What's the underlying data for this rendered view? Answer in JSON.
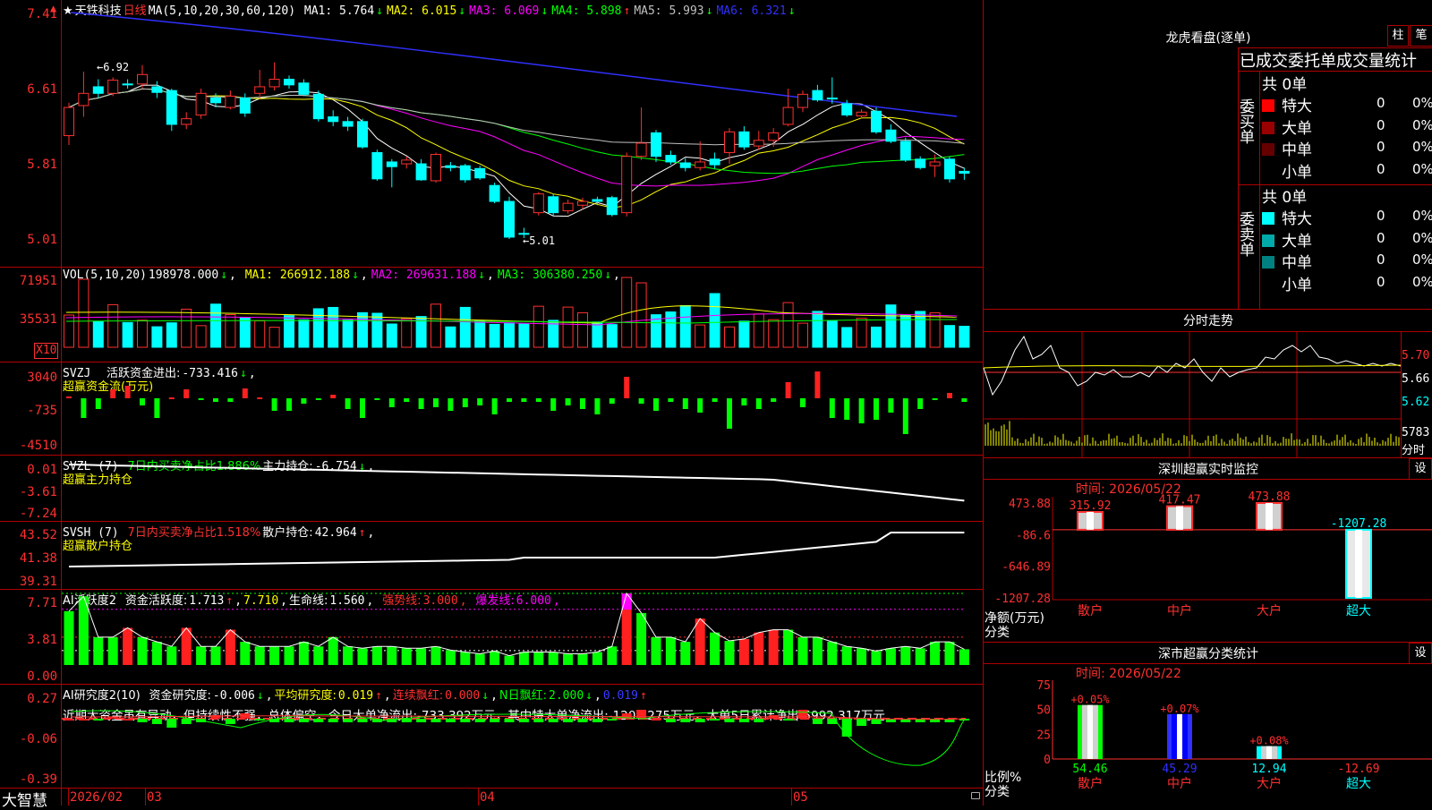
{
  "stock": {
    "star": "★",
    "name": "天铁科技",
    "period": "日线"
  },
  "kline": {
    "ma_params": "MA(5,10,20,30,60,120)",
    "ma": [
      {
        "label": "MA1:",
        "value": "5.764",
        "arrow": "↓",
        "color": "#ffffff"
      },
      {
        "label": "MA2:",
        "value": "6.015",
        "arrow": "↓",
        "color": "#ffff00"
      },
      {
        "label": "MA3:",
        "value": "6.069",
        "arrow": "↓",
        "color": "#ff00ff"
      },
      {
        "label": "MA4:",
        "value": "5.898",
        "arrow": "↑",
        "color": "#00ff00"
      },
      {
        "label": "MA5:",
        "value": "5.993",
        "arrow": "↓",
        "color": "#c0c0c0"
      },
      {
        "label": "MA6:",
        "value": "6.321",
        "arrow": "↓",
        "color": "#3030ff"
      }
    ],
    "y_ticks": [
      "7.41",
      "6.61",
      "5.81",
      "5.01"
    ],
    "high_label": "6.92",
    "low_label": "5.01",
    "candles": [
      {
        "o": 6.1,
        "c": 6.4,
        "h": 6.45,
        "l": 6.0
      },
      {
        "o": 6.42,
        "c": 6.55,
        "h": 6.78,
        "l": 6.3
      },
      {
        "o": 6.62,
        "c": 6.55,
        "h": 6.7,
        "l": 6.5
      },
      {
        "o": 6.55,
        "c": 6.69,
        "h": 6.72,
        "l": 6.52
      },
      {
        "o": 6.65,
        "c": 6.64,
        "h": 6.7,
        "l": 6.6
      },
      {
        "o": 6.65,
        "c": 6.75,
        "h": 6.85,
        "l": 6.6
      },
      {
        "o": 6.62,
        "c": 6.56,
        "h": 6.68,
        "l": 6.5
      },
      {
        "o": 6.58,
        "c": 6.22,
        "h": 6.6,
        "l": 6.15
      },
      {
        "o": 6.22,
        "c": 6.28,
        "h": 6.35,
        "l": 6.17
      },
      {
        "o": 6.32,
        "c": 6.55,
        "h": 6.6,
        "l": 6.28
      },
      {
        "o": 6.5,
        "c": 6.45,
        "h": 6.55,
        "l": 6.4
      },
      {
        "o": 6.4,
        "c": 6.52,
        "h": 6.58,
        "l": 6.38
      },
      {
        "o": 6.5,
        "c": 6.34,
        "h": 6.55,
        "l": 6.3
      },
      {
        "o": 6.55,
        "c": 6.62,
        "h": 6.8,
        "l": 6.5
      },
      {
        "o": 6.62,
        "c": 6.7,
        "h": 6.88,
        "l": 6.58
      },
      {
        "o": 6.7,
        "c": 6.64,
        "h": 6.74,
        "l": 6.6
      },
      {
        "o": 6.66,
        "c": 6.54,
        "h": 6.7,
        "l": 6.52
      },
      {
        "o": 6.54,
        "c": 6.28,
        "h": 6.58,
        "l": 6.25
      },
      {
        "o": 6.3,
        "c": 6.25,
        "h": 6.37,
        "l": 6.2
      },
      {
        "o": 6.25,
        "c": 6.2,
        "h": 6.3,
        "l": 6.15
      },
      {
        "o": 6.25,
        "c": 5.98,
        "h": 6.28,
        "l": 5.96
      },
      {
        "o": 5.92,
        "c": 5.64,
        "h": 5.95,
        "l": 5.62
      },
      {
        "o": 5.82,
        "c": 5.77,
        "h": 5.85,
        "l": 5.55
      },
      {
        "o": 5.8,
        "c": 5.84,
        "h": 5.88,
        "l": 5.75
      },
      {
        "o": 5.8,
        "c": 5.63,
        "h": 5.85,
        "l": 5.62
      },
      {
        "o": 5.62,
        "c": 5.9,
        "h": 5.92,
        "l": 5.6
      },
      {
        "o": 5.78,
        "c": 5.76,
        "h": 5.82,
        "l": 5.72
      },
      {
        "o": 5.78,
        "c": 5.63,
        "h": 5.8,
        "l": 5.6
      },
      {
        "o": 5.75,
        "c": 5.65,
        "h": 5.78,
        "l": 5.63
      },
      {
        "o": 5.57,
        "c": 5.4,
        "h": 5.6,
        "l": 5.38
      },
      {
        "o": 5.4,
        "c": 5.02,
        "h": 5.45,
        "l": 5.0
      },
      {
        "o": 5.06,
        "c": 5.05,
        "h": 5.12,
        "l": 5.01
      },
      {
        "o": 5.28,
        "c": 5.48,
        "h": 5.5,
        "l": 5.25
      },
      {
        "o": 5.45,
        "c": 5.28,
        "h": 5.48,
        "l": 5.25
      },
      {
        "o": 5.3,
        "c": 5.38,
        "h": 5.42,
        "l": 5.27
      },
      {
        "o": 5.36,
        "c": 5.4,
        "h": 5.44,
        "l": 5.32
      },
      {
        "o": 5.42,
        "c": 5.4,
        "h": 5.45,
        "l": 5.36
      },
      {
        "o": 5.44,
        "c": 5.26,
        "h": 5.46,
        "l": 5.24
      },
      {
        "o": 5.28,
        "c": 5.88,
        "h": 5.92,
        "l": 5.24
      },
      {
        "o": 5.88,
        "c": 6.02,
        "h": 6.4,
        "l": 5.84
      },
      {
        "o": 6.13,
        "c": 5.88,
        "h": 6.16,
        "l": 5.82
      },
      {
        "o": 5.89,
        "c": 5.82,
        "h": 5.94,
        "l": 5.79
      },
      {
        "o": 5.81,
        "c": 5.76,
        "h": 5.86,
        "l": 5.72
      },
      {
        "o": 5.76,
        "c": 5.82,
        "h": 6.04,
        "l": 5.73
      },
      {
        "o": 5.85,
        "c": 5.79,
        "h": 5.92,
        "l": 5.75
      },
      {
        "o": 5.92,
        "c": 6.14,
        "h": 6.18,
        "l": 5.8
      },
      {
        "o": 6.14,
        "c": 5.98,
        "h": 6.2,
        "l": 5.95
      },
      {
        "o": 5.99,
        "c": 6.05,
        "h": 6.15,
        "l": 5.95
      },
      {
        "o": 6.05,
        "c": 6.13,
        "h": 6.18,
        "l": 5.98
      },
      {
        "o": 6.22,
        "c": 6.4,
        "h": 6.6,
        "l": 6.2
      },
      {
        "o": 6.4,
        "c": 6.54,
        "h": 6.58,
        "l": 6.35
      },
      {
        "o": 6.58,
        "c": 6.48,
        "h": 6.64,
        "l": 6.46
      },
      {
        "o": 6.5,
        "c": 6.49,
        "h": 6.72,
        "l": 6.44
      },
      {
        "o": 6.44,
        "c": 6.32,
        "h": 6.48,
        "l": 6.3
      },
      {
        "o": 6.31,
        "c": 6.35,
        "h": 6.38,
        "l": 6.28
      },
      {
        "o": 6.36,
        "c": 6.14,
        "h": 6.4,
        "l": 6.12
      },
      {
        "o": 6.16,
        "c": 6.04,
        "h": 6.22,
        "l": 6.02
      },
      {
        "o": 6.04,
        "c": 5.84,
        "h": 6.08,
        "l": 5.82
      },
      {
        "o": 5.85,
        "c": 5.76,
        "h": 5.88,
        "l": 5.74
      },
      {
        "o": 5.78,
        "c": 5.82,
        "h": 5.9,
        "l": 5.66
      },
      {
        "o": 5.85,
        "c": 5.64,
        "h": 5.88,
        "l": 5.6
      },
      {
        "o": 5.72,
        "c": 5.7,
        "h": 5.76,
        "l": 5.63
      }
    ]
  },
  "vol": {
    "params": "VOL(5,10,20)",
    "value": "198978.000",
    "value_arrow": "↓",
    "ma": [
      {
        "label": "MA1:",
        "value": "266912.188",
        "arrow": "↓",
        "color": "#ffff00"
      },
      {
        "label": "MA2:",
        "value": "269631.188",
        "arrow": "↓",
        "color": "#ff00ff"
      },
      {
        "label": "MA3:",
        "value": "306380.250",
        "arrow": "↓",
        "color": "#00ff00"
      }
    ],
    "y_ticks": [
      "71951",
      "35531"
    ],
    "unit": "X10"
  },
  "svzj": {
    "name": "SVZJ",
    "label": "活跃资金进出:",
    "value": "-733.416",
    "arrow": "↓",
    "sep": ",",
    "sub": "超赢资金流(万元)",
    "y_ticks": [
      "3040",
      "-735",
      "-4510"
    ]
  },
  "svzl": {
    "name": "SVZL (7)",
    "label1": "7日内买卖净占比1.886%",
    "label2": "主力持仓:",
    "value": "-6.754",
    "arrow": "↓",
    "sep": ",",
    "sub": "超赢主力持仓",
    "y_ticks": [
      "0.01",
      "-3.61",
      "-7.24"
    ]
  },
  "svsh": {
    "name": "SVSH (7)",
    "label1": "7日内买卖净占比1.518%",
    "label2": "散户持仓:",
    "value": "42.964",
    "arrow": "↑",
    "sep": ",",
    "sub": "超赢散户持仓",
    "y_ticks": [
      "43.52",
      "41.38",
      "39.31"
    ]
  },
  "ai_active": {
    "name": "AI活跃度2",
    "label1": "资金活跃度:",
    "value1": "1.713",
    "arrow1": "↑",
    "value2": "7.710",
    "sep2": ",",
    "label3": "生命线:",
    "value3": "1.560",
    "sep3": ",",
    "label4": "强势线:",
    "value4": "3.000",
    "sep4": ",",
    "label5": "爆发线:",
    "value5": "6.000",
    "sep5": ",",
    "y_ticks": [
      "7.71",
      "3.81",
      "0.00"
    ]
  },
  "ai_research": {
    "name": "AI研究度2(10)",
    "label1": "资金研究度:",
    "value1": "-0.006",
    "arrow1": "↓",
    "label2": "平均研究度:",
    "value2": "0.019",
    "arrow2": "↑",
    "label3": "连续飘红:",
    "value3": "0.000",
    "arrow3": "↓",
    "label4": "N日飘红:",
    "value4": "2.000",
    "arrow4": "↓",
    "value5": "0.019",
    "arrow5": "↑",
    "comment": "近期大资金虽有异动，但持续性不强，总体偏空，今日大单净流出:-733.392万元，其中特大单净流出:-1207.275万元，大单5日累计净出-5992.317万元",
    "y_ticks": [
      "0.27",
      "-0.06",
      "-0.39"
    ]
  },
  "time_axis": [
    "2026/02",
    "03",
    "04",
    "05"
  ],
  "brand": "大智慧",
  "right": {
    "lhb_title": "龙虎看盘(逐单)",
    "btn_zhu": "柱",
    "btn_bi": "笔",
    "stats_title": "已成交委托单成交量统计",
    "buy": {
      "side": "委买单",
      "total": "共 0单",
      "rows": [
        {
          "label": "特大",
          "qty": "0",
          "pct": "0%",
          "color": "#ff0000"
        },
        {
          "label": "大单",
          "qty": "0",
          "pct": "0%",
          "color": "#990000"
        },
        {
          "label": "中单",
          "qty": "0",
          "pct": "0%",
          "color": "#660000"
        },
        {
          "label": "小单",
          "qty": "0",
          "pct": "0%",
          "color": "#000000"
        }
      ]
    },
    "sell": {
      "side": "委卖单",
      "total": "共 0单",
      "rows": [
        {
          "label": "特大",
          "qty": "0",
          "pct": "0%",
          "color": "#00ffff"
        },
        {
          "label": "大单",
          "qty": "0",
          "pct": "0%",
          "color": "#00aaaa"
        },
        {
          "label": "中单",
          "qty": "0",
          "pct": "0%",
          "color": "#008080"
        },
        {
          "label": "小单",
          "qty": "0",
          "pct": "0%",
          "color": "#000000"
        }
      ]
    },
    "intraday_title": "分时走势",
    "intraday_ticks": [
      "5.70",
      "5.66",
      "5.62"
    ],
    "intraday_vol": "5783",
    "intraday_vol_label": "分时",
    "monitor": {
      "title": "深圳超赢实时监控",
      "btn": "设",
      "time": "时间: 2026/05/22",
      "y_ticks": [
        "473.88",
        "-86.6",
        "-646.89",
        "-1207.28"
      ],
      "ylabel1": "净额(万元)",
      "ylabel2": "分类",
      "categories": [
        "散户",
        "中户",
        "大户",
        "超大"
      ],
      "values_label": [
        "315.92",
        "417.47",
        "473.88",
        "-1207.28"
      ]
    },
    "classify": {
      "title": "深市超赢分类统计",
      "btn": "设",
      "time": "时间: 2026/05/22",
      "y_ticks": [
        "75",
        "50",
        "25",
        "0"
      ],
      "ylabel1": "比例%",
      "ylabel2": "分类",
      "categories": [
        "散户",
        "中户",
        "大户",
        "超大"
      ],
      "pct_labels": [
        "54.46",
        "45.29",
        "12.94",
        "-12.69"
      ],
      "delta_labels": [
        "+0.05%",
        "+0.07%",
        "+0.08%"
      ]
    }
  },
  "chart_data": [
    {
      "type": "bar",
      "title": "深圳超赢实时监控",
      "ylabel": "净额(万元)",
      "xlabel": "分类",
      "categories": [
        "散户",
        "中户",
        "大户",
        "超大"
      ],
      "values": [
        315.92,
        417.47,
        473.88,
        -1207.28
      ],
      "ylim": [
        -1207.28,
        473.88
      ]
    },
    {
      "type": "bar",
      "title": "深市超赢分类统计",
      "ylabel": "比例%",
      "xlabel": "分类",
      "categories": [
        "散户",
        "中户",
        "大户",
        "超大"
      ],
      "values": [
        54.46,
        45.29,
        12.94,
        -12.69
      ],
      "ylim": [
        0,
        75
      ]
    }
  ]
}
